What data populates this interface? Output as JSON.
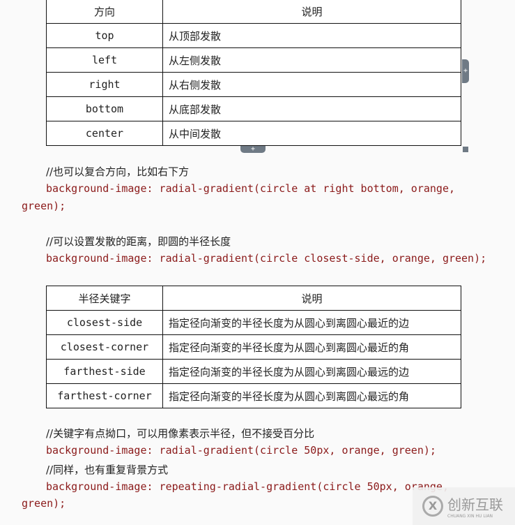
{
  "table1": {
    "headers": [
      "方向",
      "说明"
    ],
    "rows": [
      [
        "top",
        "从顶部发散"
      ],
      [
        "left",
        "从左侧发散"
      ],
      [
        "right",
        "从右侧发散"
      ],
      [
        "bottom",
        "从底部发散"
      ],
      [
        "center",
        "从中间发散"
      ]
    ]
  },
  "lines1": {
    "comment": "//也可以复合方向，比如右下方",
    "code": "background-image: radial-gradient(circle at right bottom, orange,",
    "wrap": "green);"
  },
  "lines2": {
    "comment": "//可以设置发散的距离，即圆的半径长度",
    "code": "background-image: radial-gradient(circle closest-side, orange, green);"
  },
  "table2": {
    "headers": [
      "半径关键字",
      "说明"
    ],
    "rows": [
      [
        "closest-side",
        "指定径向渐变的半径长度为从圆心到离圆心最近的边"
      ],
      [
        "closest-corner",
        "指定径向渐变的半径长度为从圆心到离圆心最近的角"
      ],
      [
        "farthest-side",
        "指定径向渐变的半径长度为从圆心到离圆心最远的边"
      ],
      [
        "farthest-corner",
        "指定径向渐变的半径长度为从圆心到离圆心最远的角"
      ]
    ]
  },
  "lines3": {
    "comment": "//关键字有点拗口，可以用像素表示半径，但不接受百分比",
    "code": "background-image: radial-gradient(circle 50px, orange, green);",
    "comment2": "//同样，也有重复背景方式",
    "code2": "background-image: repeating-radial-gradient(circle 50px, orange,",
    "wrap": "green);"
  },
  "watermark": {
    "name": "创新互联",
    "sub": "CHUANG XIN HU LIAN"
  }
}
